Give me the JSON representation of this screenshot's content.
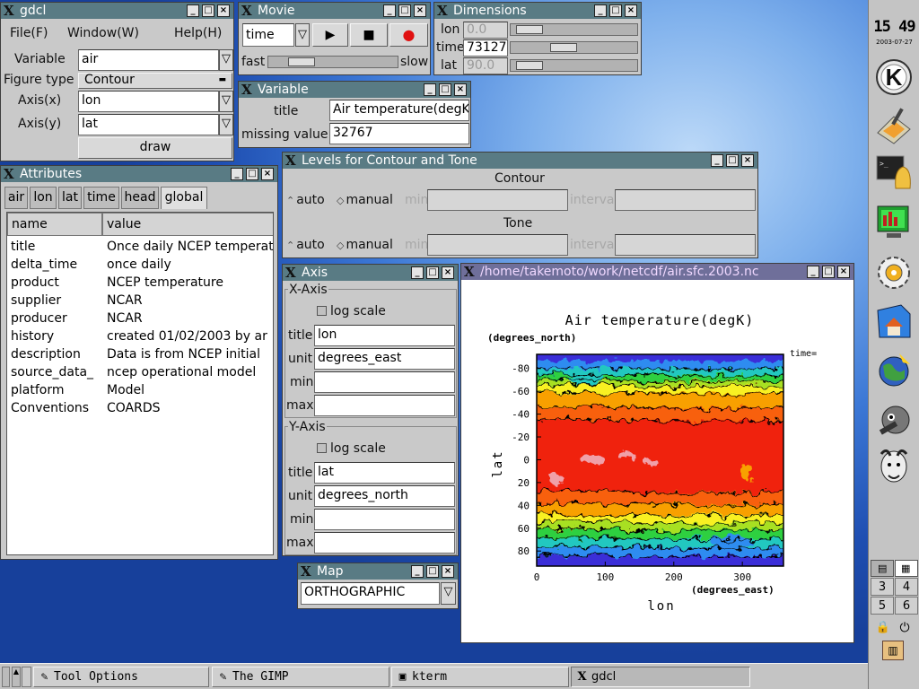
{
  "gdcl": {
    "title": "gdcl",
    "menu": {
      "file": "File(F)",
      "window": "Window(W)",
      "help": "Help(H)"
    },
    "variable_label": "Variable",
    "variable_value": "air",
    "figtype_label": "Figure type",
    "figtype_value": "Contour",
    "axisx_label": "Axis(x)",
    "axisx_value": "lon",
    "axisy_label": "Axis(y)",
    "axisy_value": "lat",
    "draw_label": "draw"
  },
  "movie": {
    "title": "Movie",
    "selector": "time",
    "fast": "fast",
    "slow": "slow",
    "play_slider": 0.2
  },
  "dimensions": {
    "title": "Dimensions",
    "rows": [
      {
        "name": "lon",
        "value": "0.0",
        "slider": 0.05
      },
      {
        "name": "time",
        "value": "73127",
        "slider": 0.4
      },
      {
        "name": "lat",
        "value": "90.0",
        "slider": 0.05
      }
    ]
  },
  "variable": {
    "title": "Variable",
    "title_label": "title",
    "title_value": "Air temperature(degK)",
    "missing_label": "missing value",
    "missing_value": "32767"
  },
  "levels": {
    "title": "Levels for Contour and Tone",
    "contour_header": "Contour",
    "tone_header": "Tone",
    "auto": "auto",
    "manual": "manual",
    "min": "min",
    "interval": "interval"
  },
  "attributes": {
    "title": "Attributes",
    "tabs": [
      "air",
      "lon",
      "lat",
      "time",
      "head",
      "global"
    ],
    "selected_tab": "global",
    "col_name": "name",
    "col_value": "value",
    "rows": [
      {
        "name": "title",
        "value": "Once daily NCEP temperature"
      },
      {
        "name": "delta_time",
        "value": "once daily"
      },
      {
        "name": "product",
        "value": "NCEP temperature"
      },
      {
        "name": "supplier",
        "value": "NCAR"
      },
      {
        "name": "producer",
        "value": "NCAR"
      },
      {
        "name": "history",
        "value": "created 01/02/2003 by ar"
      },
      {
        "name": "description",
        "value": "Data is from NCEP initial"
      },
      {
        "name": "source_data_",
        "value": "ncep operational model"
      },
      {
        "name": "platform",
        "value": "Model"
      },
      {
        "name": "Conventions",
        "value": "COARDS"
      }
    ]
  },
  "axis": {
    "title": "Axis",
    "x_group": "X-Axis",
    "y_group": "Y-Axis",
    "log_scale": "log scale",
    "title_label": "title",
    "unit_label": "unit",
    "min_label": "min",
    "max_label": "max",
    "x_title": "lon",
    "x_unit": "degrees_east",
    "y_title": "lat",
    "y_unit": "degrees_north"
  },
  "map": {
    "title": "Map",
    "value": "ORTHOGRAPHIC"
  },
  "plot": {
    "title": "/home/takemoto/work/netcdf/air.sfc.2003.nc",
    "heading": "Air temperature(degK)",
    "y_units": "(degrees_north)",
    "x_units": "(degrees_east)",
    "xlabel": "lon",
    "ylabel": "lat",
    "time_label": "time=",
    "yticks": [
      "-80",
      "-60",
      "-40",
      "-20",
      "0",
      "20",
      "40",
      "60",
      "80"
    ],
    "xticks": [
      "0",
      "100",
      "200",
      "300"
    ]
  },
  "clock": {
    "time": "15 49",
    "date": "2003-07-27"
  },
  "pager": [
    "3",
    "4",
    "5",
    "6"
  ],
  "taskbar": {
    "items": [
      {
        "label": "Tool Options"
      },
      {
        "label": "The GIMP"
      },
      {
        "label": "kterm"
      },
      {
        "label": "gdcl"
      }
    ]
  },
  "colors": {
    "titlebar": "#597b84",
    "desktop": "#2c62c4"
  },
  "icons": [
    "k-menu-icon",
    "editor-icon",
    "terminal-shell-icon",
    "monitor-icon",
    "settings-gear-icon",
    "home-folder-icon",
    "web-browser-icon",
    "gimp-icon",
    "gnu-icon"
  ]
}
